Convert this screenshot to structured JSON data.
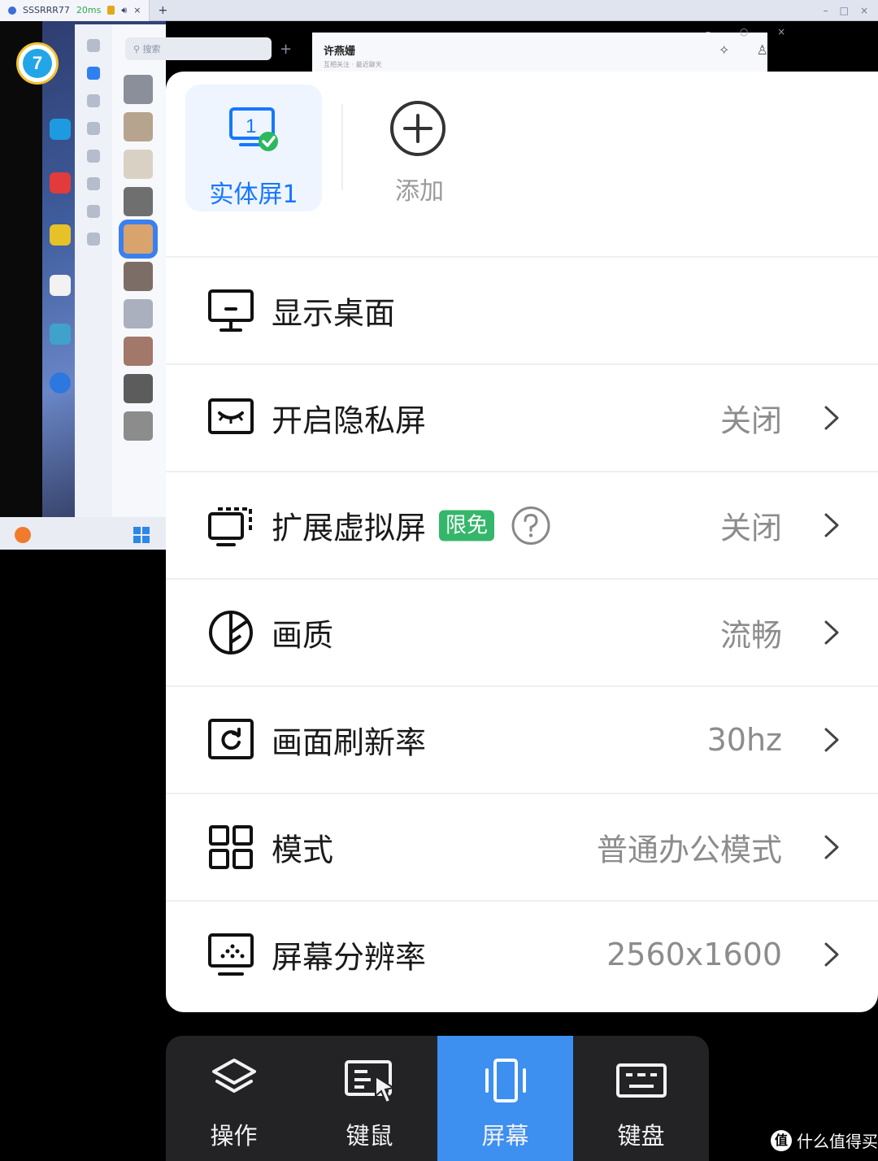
{
  "remote": {
    "tab_title": "SSSRRR77",
    "latency": "20ms",
    "search_placeholder": "搜索",
    "chat_name": "许燕姗",
    "chat_sub": "互相关注 · 最近聊天"
  },
  "screens": {
    "physical_label": "实体屏1",
    "physical_number": "1",
    "add_label": "添加"
  },
  "menu": [
    {
      "icon": "monitor-icon",
      "label": "显示桌面",
      "value": "",
      "chevron": false
    },
    {
      "icon": "privacy-eye-icon",
      "label": "开启隐私屏",
      "value": "关闭",
      "chevron": true
    },
    {
      "icon": "virtual-screen-icon",
      "label": "扩展虚拟屏",
      "tag": "限免",
      "help": true,
      "value": "关闭",
      "chevron": true
    },
    {
      "icon": "quality-icon",
      "label": "画质",
      "value": "流畅",
      "chevron": true
    },
    {
      "icon": "refresh-icon",
      "label": "画面刷新率",
      "value": "30hz",
      "chevron": true
    },
    {
      "icon": "grid-mode-icon",
      "label": "模式",
      "value": "普通办公模式",
      "chevron": true
    },
    {
      "icon": "resolution-icon",
      "label": "屏幕分辨率",
      "value": "2560x1600",
      "chevron": true
    }
  ],
  "toolbar": [
    {
      "icon": "layers-icon",
      "label": "操作",
      "active": false
    },
    {
      "icon": "keyboard-mouse-icon",
      "label": "键鼠",
      "active": false
    },
    {
      "icon": "screen-icon",
      "label": "屏幕",
      "active": true
    },
    {
      "icon": "keyboard-icon",
      "label": "键盘",
      "active": false
    }
  ],
  "watermark": {
    "logo_text": "值",
    "text": "什么值得买"
  },
  "colors": {
    "accent": "#1677ff",
    "active_tab": "#3d8ff0",
    "free_tag": "#34b76a",
    "toolbar_bg": "#232326"
  }
}
